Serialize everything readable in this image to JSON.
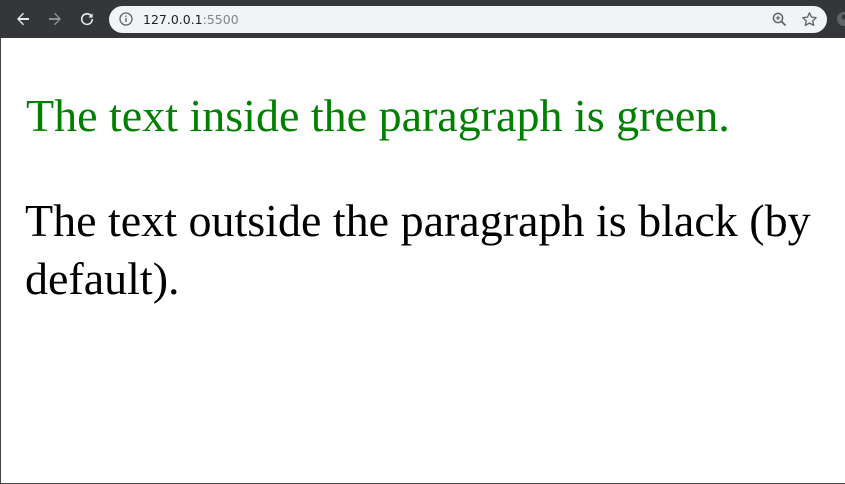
{
  "browser": {
    "url_host": "127.0.0.1",
    "url_port": ":5500",
    "icons": {
      "back": "back-arrow-icon",
      "forward": "forward-arrow-icon",
      "reload": "reload-icon",
      "info": "info-icon",
      "zoom": "zoom-icon",
      "bookmark": "star-icon"
    },
    "colors": {
      "toolbar": "#35363a",
      "omnibox": "#f1f3f4"
    }
  },
  "page": {
    "paragraph_text": "The text inside the paragraph is green.",
    "outside_text": "The text outside the paragraph is black (by default).",
    "colors": {
      "paragraph": "#008000",
      "outside": "#000000"
    }
  }
}
